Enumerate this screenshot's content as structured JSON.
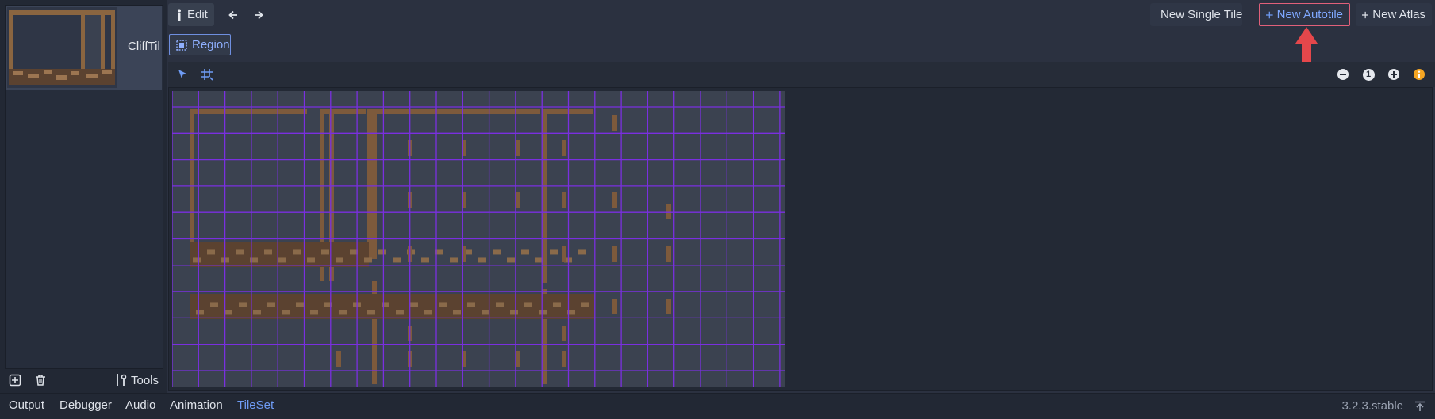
{
  "texture_list": {
    "items": [
      {
        "name": "CliffTil"
      }
    ]
  },
  "left_toolbar": {
    "add_icon": "add-texture-icon",
    "delete_icon": "trash-icon",
    "tools_label": "Tools"
  },
  "toolbar": {
    "edit_label": "Edit",
    "region_label": "Region",
    "new_single_tile_label": "New Single Tile",
    "new_autotile_label": "New Autotile",
    "new_atlas_label": "New Atlas"
  },
  "zoom": {
    "reset_label": "1"
  },
  "bottom_tabs": [
    {
      "label": "Output"
    },
    {
      "label": "Debugger"
    },
    {
      "label": "Audio"
    },
    {
      "label": "Animation"
    },
    {
      "label": "TileSet",
      "active": true
    }
  ],
  "version": "3.2.3.stable",
  "colors": {
    "accent": "#6f9cf5",
    "grid": "#7a2fe0",
    "tile_dirt": "#7d5a3c",
    "highlight_border": "#e0607a",
    "arrow": "#e5474b",
    "plus_yellow": "#f0e040"
  }
}
